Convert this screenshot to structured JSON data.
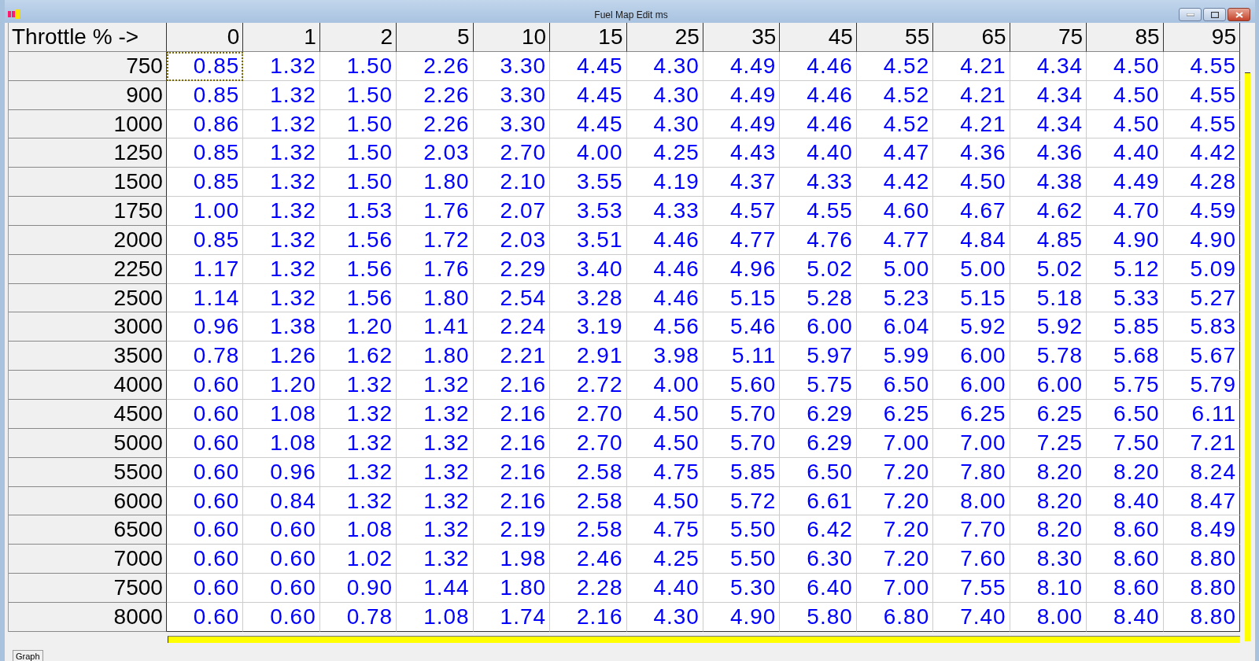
{
  "window": {
    "title": "Fuel Map Edit ms"
  },
  "table": {
    "corner": "Throttle % ->",
    "columns": [
      "0",
      "1",
      "2",
      "5",
      "10",
      "15",
      "25",
      "35",
      "45",
      "55",
      "65",
      "75",
      "85",
      "95"
    ],
    "rows": [
      {
        "rpm": "750",
        "cells": [
          {
            "v": "0.85",
            "selected": true
          },
          {
            "v": "1.32",
            "selected": false
          },
          {
            "v": "1.50",
            "selected": false
          },
          {
            "v": "2.26",
            "selected": false
          },
          {
            "v": "3.30",
            "selected": false
          },
          {
            "v": "4.45",
            "selected": false
          },
          {
            "v": "4.30",
            "selected": false
          },
          {
            "v": "4.49",
            "selected": false
          },
          {
            "v": "4.46",
            "selected": false
          },
          {
            "v": "4.52",
            "selected": false
          },
          {
            "v": "4.21",
            "selected": false
          },
          {
            "v": "4.34",
            "selected": false
          },
          {
            "v": "4.50",
            "selected": false
          },
          {
            "v": "4.55",
            "selected": false
          }
        ]
      },
      {
        "rpm": "900",
        "cells": [
          {
            "v": "0.85",
            "selected": false
          },
          {
            "v": "1.32",
            "selected": false
          },
          {
            "v": "1.50",
            "selected": false
          },
          {
            "v": "2.26",
            "selected": false
          },
          {
            "v": "3.30",
            "selected": false
          },
          {
            "v": "4.45",
            "selected": false
          },
          {
            "v": "4.30",
            "selected": false
          },
          {
            "v": "4.49",
            "selected": false
          },
          {
            "v": "4.46",
            "selected": false
          },
          {
            "v": "4.52",
            "selected": false
          },
          {
            "v": "4.21",
            "selected": false
          },
          {
            "v": "4.34",
            "selected": false
          },
          {
            "v": "4.50",
            "selected": false
          },
          {
            "v": "4.55",
            "selected": false
          }
        ]
      },
      {
        "rpm": "1000",
        "cells": [
          {
            "v": "0.86",
            "selected": false
          },
          {
            "v": "1.32",
            "selected": false
          },
          {
            "v": "1.50",
            "selected": false
          },
          {
            "v": "2.26",
            "selected": false
          },
          {
            "v": "3.30",
            "selected": false
          },
          {
            "v": "4.45",
            "selected": false
          },
          {
            "v": "4.30",
            "selected": false
          },
          {
            "v": "4.49",
            "selected": false
          },
          {
            "v": "4.46",
            "selected": false
          },
          {
            "v": "4.52",
            "selected": false
          },
          {
            "v": "4.21",
            "selected": false
          },
          {
            "v": "4.34",
            "selected": false
          },
          {
            "v": "4.50",
            "selected": false
          },
          {
            "v": "4.55",
            "selected": false
          }
        ]
      },
      {
        "rpm": "1250",
        "cells": [
          {
            "v": "0.85",
            "selected": false
          },
          {
            "v": "1.32",
            "selected": false
          },
          {
            "v": "1.50",
            "selected": false
          },
          {
            "v": "2.03",
            "selected": false
          },
          {
            "v": "2.70",
            "selected": false
          },
          {
            "v": "4.00",
            "selected": false
          },
          {
            "v": "4.25",
            "selected": false
          },
          {
            "v": "4.43",
            "selected": false
          },
          {
            "v": "4.40",
            "selected": false
          },
          {
            "v": "4.47",
            "selected": false
          },
          {
            "v": "4.36",
            "selected": false
          },
          {
            "v": "4.36",
            "selected": false
          },
          {
            "v": "4.40",
            "selected": false
          },
          {
            "v": "4.42",
            "selected": false
          }
        ]
      },
      {
        "rpm": "1500",
        "cells": [
          {
            "v": "0.85",
            "selected": false
          },
          {
            "v": "1.32",
            "selected": false
          },
          {
            "v": "1.50",
            "selected": false
          },
          {
            "v": "1.80",
            "selected": false
          },
          {
            "v": "2.10",
            "selected": false
          },
          {
            "v": "3.55",
            "selected": false
          },
          {
            "v": "4.19",
            "selected": false
          },
          {
            "v": "4.37",
            "selected": false
          },
          {
            "v": "4.33",
            "selected": false
          },
          {
            "v": "4.42",
            "selected": false
          },
          {
            "v": "4.50",
            "selected": false
          },
          {
            "v": "4.38",
            "selected": false
          },
          {
            "v": "4.49",
            "selected": false
          },
          {
            "v": "4.28",
            "selected": false
          }
        ]
      },
      {
        "rpm": "1750",
        "cells": [
          {
            "v": "1.00",
            "selected": false
          },
          {
            "v": "1.32",
            "selected": false
          },
          {
            "v": "1.53",
            "selected": false
          },
          {
            "v": "1.76",
            "selected": false
          },
          {
            "v": "2.07",
            "selected": false
          },
          {
            "v": "3.53",
            "selected": false
          },
          {
            "v": "4.33",
            "selected": false
          },
          {
            "v": "4.57",
            "selected": false
          },
          {
            "v": "4.55",
            "selected": false
          },
          {
            "v": "4.60",
            "selected": false
          },
          {
            "v": "4.67",
            "selected": false
          },
          {
            "v": "4.62",
            "selected": false
          },
          {
            "v": "4.70",
            "selected": false
          },
          {
            "v": "4.59",
            "selected": false
          }
        ]
      },
      {
        "rpm": "2000",
        "cells": [
          {
            "v": "0.85",
            "selected": false
          },
          {
            "v": "1.32",
            "selected": false
          },
          {
            "v": "1.56",
            "selected": false
          },
          {
            "v": "1.72",
            "selected": false
          },
          {
            "v": "2.03",
            "selected": false
          },
          {
            "v": "3.51",
            "selected": false
          },
          {
            "v": "4.46",
            "selected": false
          },
          {
            "v": "4.77",
            "selected": false
          },
          {
            "v": "4.76",
            "selected": false
          },
          {
            "v": "4.77",
            "selected": false
          },
          {
            "v": "4.84",
            "selected": false
          },
          {
            "v": "4.85",
            "selected": false
          },
          {
            "v": "4.90",
            "selected": false
          },
          {
            "v": "4.90",
            "selected": false
          }
        ]
      },
      {
        "rpm": "2250",
        "cells": [
          {
            "v": "1.17",
            "selected": false
          },
          {
            "v": "1.32",
            "selected": false
          },
          {
            "v": "1.56",
            "selected": false
          },
          {
            "v": "1.76",
            "selected": false
          },
          {
            "v": "2.29",
            "selected": false
          },
          {
            "v": "3.40",
            "selected": false
          },
          {
            "v": "4.46",
            "selected": false
          },
          {
            "v": "4.96",
            "selected": false
          },
          {
            "v": "5.02",
            "selected": false
          },
          {
            "v": "5.00",
            "selected": false
          },
          {
            "v": "5.00",
            "selected": false
          },
          {
            "v": "5.02",
            "selected": false
          },
          {
            "v": "5.12",
            "selected": false
          },
          {
            "v": "5.09",
            "selected": false
          }
        ]
      },
      {
        "rpm": "2500",
        "cells": [
          {
            "v": "1.14",
            "selected": false
          },
          {
            "v": "1.32",
            "selected": false
          },
          {
            "v": "1.56",
            "selected": false
          },
          {
            "v": "1.80",
            "selected": false
          },
          {
            "v": "2.54",
            "selected": false
          },
          {
            "v": "3.28",
            "selected": false
          },
          {
            "v": "4.46",
            "selected": false
          },
          {
            "v": "5.15",
            "selected": false
          },
          {
            "v": "5.28",
            "selected": false
          },
          {
            "v": "5.23",
            "selected": false
          },
          {
            "v": "5.15",
            "selected": false
          },
          {
            "v": "5.18",
            "selected": false
          },
          {
            "v": "5.33",
            "selected": false
          },
          {
            "v": "5.27",
            "selected": false
          }
        ]
      },
      {
        "rpm": "3000",
        "cells": [
          {
            "v": "0.96",
            "selected": false
          },
          {
            "v": "1.38",
            "selected": false
          },
          {
            "v": "1.20",
            "selected": false
          },
          {
            "v": "1.41",
            "selected": false
          },
          {
            "v": "2.24",
            "selected": false
          },
          {
            "v": "3.19",
            "selected": false
          },
          {
            "v": "4.56",
            "selected": false
          },
          {
            "v": "5.46",
            "selected": false
          },
          {
            "v": "6.00",
            "selected": false
          },
          {
            "v": "6.04",
            "selected": false
          },
          {
            "v": "5.92",
            "selected": false
          },
          {
            "v": "5.92",
            "selected": false
          },
          {
            "v": "5.85",
            "selected": false
          },
          {
            "v": "5.83",
            "selected": false
          }
        ]
      },
      {
        "rpm": "3500",
        "cells": [
          {
            "v": "0.78",
            "selected": false
          },
          {
            "v": "1.26",
            "selected": false
          },
          {
            "v": "1.62",
            "selected": false
          },
          {
            "v": "1.80",
            "selected": false
          },
          {
            "v": "2.21",
            "selected": false
          },
          {
            "v": "2.91",
            "selected": false
          },
          {
            "v": "3.98",
            "selected": false
          },
          {
            "v": "5.11",
            "selected": false
          },
          {
            "v": "5.97",
            "selected": false
          },
          {
            "v": "5.99",
            "selected": false
          },
          {
            "v": "6.00",
            "selected": false
          },
          {
            "v": "5.78",
            "selected": false
          },
          {
            "v": "5.68",
            "selected": false
          },
          {
            "v": "5.67",
            "selected": false
          }
        ]
      },
      {
        "rpm": "4000",
        "cells": [
          {
            "v": "0.60",
            "selected": false
          },
          {
            "v": "1.20",
            "selected": false
          },
          {
            "v": "1.32",
            "selected": false
          },
          {
            "v": "1.32",
            "selected": false
          },
          {
            "v": "2.16",
            "selected": false
          },
          {
            "v": "2.72",
            "selected": false
          },
          {
            "v": "4.00",
            "selected": false
          },
          {
            "v": "5.60",
            "selected": false
          },
          {
            "v": "5.75",
            "selected": false
          },
          {
            "v": "6.50",
            "selected": false
          },
          {
            "v": "6.00",
            "selected": false
          },
          {
            "v": "6.00",
            "selected": false
          },
          {
            "v": "5.75",
            "selected": false
          },
          {
            "v": "5.79",
            "selected": false
          }
        ]
      },
      {
        "rpm": "4500",
        "cells": [
          {
            "v": "0.60",
            "selected": false
          },
          {
            "v": "1.08",
            "selected": false
          },
          {
            "v": "1.32",
            "selected": false
          },
          {
            "v": "1.32",
            "selected": false
          },
          {
            "v": "2.16",
            "selected": false
          },
          {
            "v": "2.70",
            "selected": false
          },
          {
            "v": "4.50",
            "selected": false
          },
          {
            "v": "5.70",
            "selected": false
          },
          {
            "v": "6.29",
            "selected": false
          },
          {
            "v": "6.25",
            "selected": false
          },
          {
            "v": "6.25",
            "selected": false
          },
          {
            "v": "6.25",
            "selected": false
          },
          {
            "v": "6.50",
            "selected": false
          },
          {
            "v": "6.11",
            "selected": false
          }
        ]
      },
      {
        "rpm": "5000",
        "cells": [
          {
            "v": "0.60",
            "selected": false
          },
          {
            "v": "1.08",
            "selected": false
          },
          {
            "v": "1.32",
            "selected": false
          },
          {
            "v": "1.32",
            "selected": false
          },
          {
            "v": "2.16",
            "selected": false
          },
          {
            "v": "2.70",
            "selected": false
          },
          {
            "v": "4.50",
            "selected": false
          },
          {
            "v": "5.70",
            "selected": false
          },
          {
            "v": "6.29",
            "selected": false
          },
          {
            "v": "7.00",
            "selected": false
          },
          {
            "v": "7.00",
            "selected": false
          },
          {
            "v": "7.25",
            "selected": false
          },
          {
            "v": "7.50",
            "selected": false
          },
          {
            "v": "7.21",
            "selected": false
          }
        ]
      },
      {
        "rpm": "5500",
        "cells": [
          {
            "v": "0.60",
            "selected": false
          },
          {
            "v": "0.96",
            "selected": false
          },
          {
            "v": "1.32",
            "selected": false
          },
          {
            "v": "1.32",
            "selected": false
          },
          {
            "v": "2.16",
            "selected": false
          },
          {
            "v": "2.58",
            "selected": false
          },
          {
            "v": "4.75",
            "selected": false
          },
          {
            "v": "5.85",
            "selected": false
          },
          {
            "v": "6.50",
            "selected": false
          },
          {
            "v": "7.20",
            "selected": false
          },
          {
            "v": "7.80",
            "selected": false
          },
          {
            "v": "8.20",
            "selected": false
          },
          {
            "v": "8.20",
            "selected": false
          },
          {
            "v": "8.24",
            "selected": false
          }
        ]
      },
      {
        "rpm": "6000",
        "cells": [
          {
            "v": "0.60",
            "selected": false
          },
          {
            "v": "0.84",
            "selected": false
          },
          {
            "v": "1.32",
            "selected": false
          },
          {
            "v": "1.32",
            "selected": false
          },
          {
            "v": "2.16",
            "selected": false
          },
          {
            "v": "2.58",
            "selected": false
          },
          {
            "v": "4.50",
            "selected": false
          },
          {
            "v": "5.72",
            "selected": false
          },
          {
            "v": "6.61",
            "selected": false
          },
          {
            "v": "7.20",
            "selected": false
          },
          {
            "v": "8.00",
            "selected": false
          },
          {
            "v": "8.20",
            "selected": false
          },
          {
            "v": "8.40",
            "selected": false
          },
          {
            "v": "8.47",
            "selected": false
          }
        ]
      },
      {
        "rpm": "6500",
        "cells": [
          {
            "v": "0.60",
            "selected": false
          },
          {
            "v": "0.60",
            "selected": false
          },
          {
            "v": "1.08",
            "selected": false
          },
          {
            "v": "1.32",
            "selected": false
          },
          {
            "v": "2.19",
            "selected": false
          },
          {
            "v": "2.58",
            "selected": false
          },
          {
            "v": "4.75",
            "selected": false
          },
          {
            "v": "5.50",
            "selected": false
          },
          {
            "v": "6.42",
            "selected": false
          },
          {
            "v": "7.20",
            "selected": false
          },
          {
            "v": "7.70",
            "selected": false
          },
          {
            "v": "8.20",
            "selected": false
          },
          {
            "v": "8.60",
            "selected": false
          },
          {
            "v": "8.49",
            "selected": false
          }
        ]
      },
      {
        "rpm": "7000",
        "cells": [
          {
            "v": "0.60",
            "selected": false
          },
          {
            "v": "0.60",
            "selected": false
          },
          {
            "v": "1.02",
            "selected": false
          },
          {
            "v": "1.32",
            "selected": false
          },
          {
            "v": "1.98",
            "selected": false
          },
          {
            "v": "2.46",
            "selected": false
          },
          {
            "v": "4.25",
            "selected": false
          },
          {
            "v": "5.50",
            "selected": false
          },
          {
            "v": "6.30",
            "selected": false
          },
          {
            "v": "7.20",
            "selected": false
          },
          {
            "v": "7.60",
            "selected": false
          },
          {
            "v": "8.30",
            "selected": false
          },
          {
            "v": "8.60",
            "selected": false
          },
          {
            "v": "8.80",
            "selected": false
          }
        ]
      },
      {
        "rpm": "7500",
        "cells": [
          {
            "v": "0.60",
            "selected": false
          },
          {
            "v": "0.60",
            "selected": false
          },
          {
            "v": "0.90",
            "selected": false
          },
          {
            "v": "1.44",
            "selected": false
          },
          {
            "v": "1.80",
            "selected": false
          },
          {
            "v": "2.28",
            "selected": false
          },
          {
            "v": "4.40",
            "selected": false
          },
          {
            "v": "5.30",
            "selected": false
          },
          {
            "v": "6.40",
            "selected": false
          },
          {
            "v": "7.00",
            "selected": false
          },
          {
            "v": "7.55",
            "selected": false
          },
          {
            "v": "8.10",
            "selected": false
          },
          {
            "v": "8.60",
            "selected": false
          },
          {
            "v": "8.80",
            "selected": false
          }
        ]
      },
      {
        "rpm": "8000",
        "cells": [
          {
            "v": "0.60",
            "selected": false
          },
          {
            "v": "0.60",
            "selected": false
          },
          {
            "v": "0.78",
            "selected": false
          },
          {
            "v": "1.08",
            "selected": false
          },
          {
            "v": "1.74",
            "selected": false
          },
          {
            "v": "2.16",
            "selected": false
          },
          {
            "v": "4.30",
            "selected": false
          },
          {
            "v": "4.90",
            "selected": false
          },
          {
            "v": "5.80",
            "selected": false
          },
          {
            "v": "6.80",
            "selected": false
          },
          {
            "v": "7.40",
            "selected": false
          },
          {
            "v": "8.00",
            "selected": false
          },
          {
            "v": "8.40",
            "selected": false
          },
          {
            "v": "8.80",
            "selected": false
          }
        ]
      }
    ]
  },
  "tabs": [
    {
      "label": "Graph",
      "selected": false
    }
  ]
}
